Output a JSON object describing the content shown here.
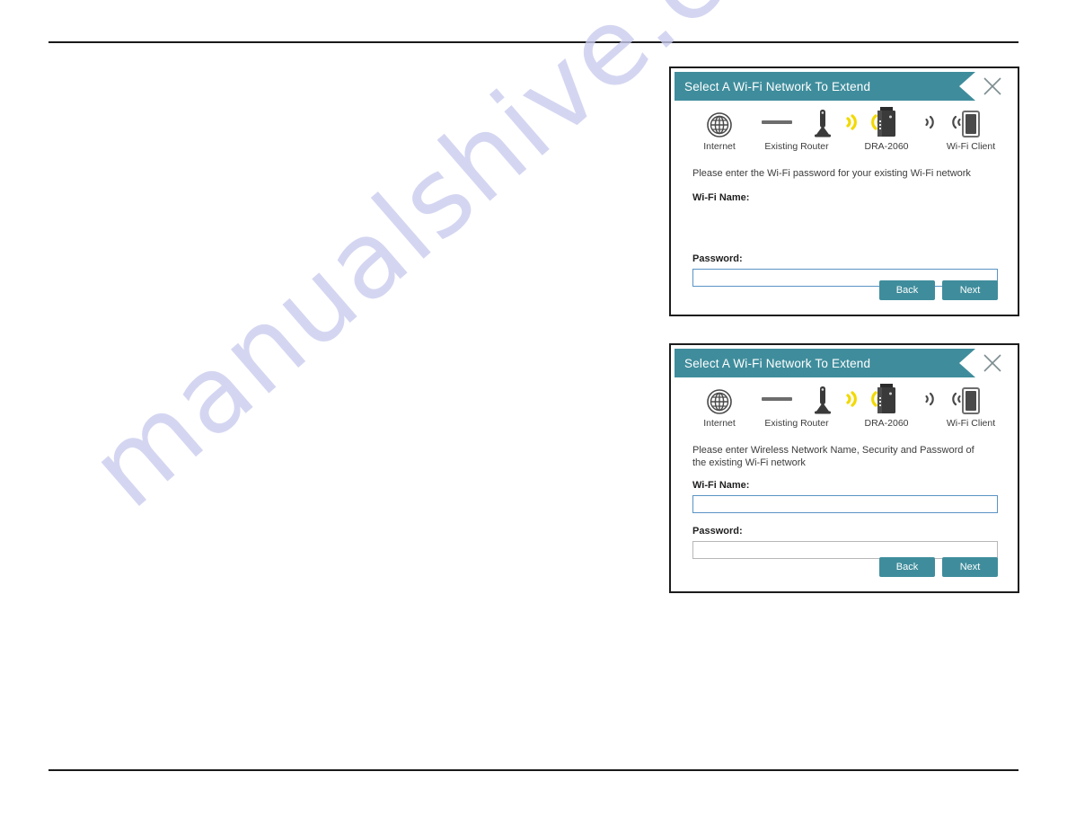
{
  "page": {
    "watermark_text": "manualshive.com"
  },
  "dialogs": [
    {
      "id": "dialog-1",
      "title": "Select A Wi-Fi Network To Extend",
      "close_icon": "close-icon",
      "topology": {
        "nodes": [
          {
            "icon": "globe-icon",
            "label": "Internet"
          },
          {
            "icon": "router-icon",
            "label": "Existing Router"
          },
          {
            "icon": "extender-icon",
            "label": "DRA-2060"
          },
          {
            "icon": "wifi-client-icon",
            "label": "Wi-Fi Client"
          }
        ],
        "links": [
          {
            "type": "wired-link",
            "color": "#6d6d6d"
          },
          {
            "type": "wireless-link",
            "color": "#f2d900"
          },
          {
            "type": "wireless-link",
            "color": "#4a4a4a"
          }
        ]
      },
      "instruction": "Please enter the Wi-Fi password for your existing Wi-Fi network",
      "fields": [
        {
          "label": "Wi-Fi Name:",
          "value": "",
          "placeholder": "",
          "input_shown": false,
          "focused": false
        },
        {
          "label": "Password:",
          "value": "",
          "placeholder": "",
          "input_shown": true,
          "focused": true
        }
      ],
      "buttons": {
        "back_label": "Back",
        "next_label": "Next"
      }
    },
    {
      "id": "dialog-2",
      "title": "Select A Wi-Fi Network To Extend",
      "close_icon": "close-icon",
      "topology": {
        "nodes": [
          {
            "icon": "globe-icon",
            "label": "Internet"
          },
          {
            "icon": "router-icon",
            "label": "Existing Router"
          },
          {
            "icon": "extender-icon",
            "label": "DRA-2060"
          },
          {
            "icon": "wifi-client-icon",
            "label": "Wi-Fi Client"
          }
        ],
        "links": [
          {
            "type": "wired-link",
            "color": "#6d6d6d"
          },
          {
            "type": "wireless-link",
            "color": "#f2d900"
          },
          {
            "type": "wireless-link",
            "color": "#4a4a4a"
          }
        ]
      },
      "instruction": "Please enter Wireless Network Name, Security and Password of the existing Wi-Fi network",
      "fields": [
        {
          "label": "Wi-Fi Name:",
          "value": "",
          "placeholder": "",
          "input_shown": true,
          "focused": true
        },
        {
          "label": "Password:",
          "value": "",
          "placeholder": "",
          "input_shown": true,
          "focused": false
        }
      ],
      "buttons": {
        "back_label": "Back",
        "next_label": "Next"
      }
    }
  ],
  "colors": {
    "header_teal": "#3f8d9c",
    "button_teal": "#3f8d9c",
    "signal_yellow": "#f2d900",
    "signal_dark": "#4a4a4a",
    "border_dark": "#1c1c1c",
    "watermark": "#c9cbee"
  }
}
